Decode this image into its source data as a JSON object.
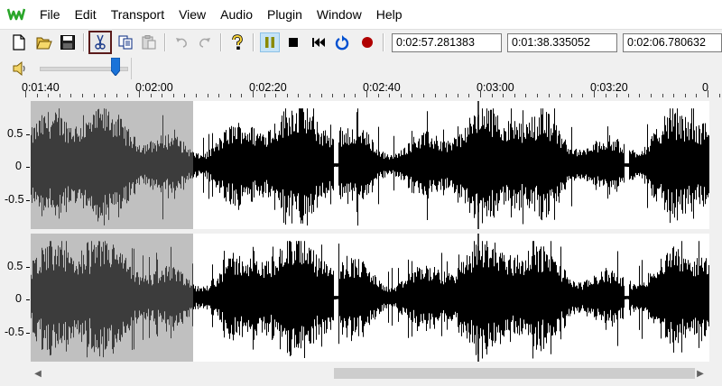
{
  "menu": {
    "items": [
      "File",
      "Edit",
      "Transport",
      "View",
      "Audio",
      "Plugin",
      "Window",
      "Help"
    ]
  },
  "toolbar": {
    "buttons": [
      {
        "name": "new-file-button",
        "icon": "new-file-icon"
      },
      {
        "name": "open-button",
        "icon": "folder-open-icon"
      },
      {
        "name": "save-button",
        "icon": "save-icon"
      },
      {
        "name": "cut-button",
        "icon": "scissors-icon",
        "highlighted": true
      },
      {
        "name": "copy-button",
        "icon": "copy-icon"
      },
      {
        "name": "paste-button",
        "icon": "paste-icon",
        "disabled": true
      },
      {
        "name": "undo-button",
        "icon": "undo-icon",
        "disabled": true
      },
      {
        "name": "redo-button",
        "icon": "redo-icon",
        "disabled": true
      },
      {
        "name": "help-button",
        "icon": "question-icon"
      },
      {
        "name": "pause-button",
        "icon": "pause-icon",
        "active": true
      },
      {
        "name": "stop-button",
        "icon": "stop-icon"
      },
      {
        "name": "rewind-button",
        "icon": "skip-back-icon"
      },
      {
        "name": "loop-button",
        "icon": "loop-icon"
      },
      {
        "name": "record-button",
        "icon": "record-icon"
      }
    ],
    "time_cursor": "0:02:57.281383",
    "time_selection_start": "0:01:38.335052",
    "time_selection_end": "0:02:06.780632"
  },
  "volume": {
    "icon": "speaker-icon",
    "level": 0.9
  },
  "ruler": {
    "labels": [
      "0:01:40",
      "0:02:00",
      "0:02:20",
      "0:02:40",
      "0:03:00",
      "0:03:20",
      "0"
    ]
  },
  "scale": {
    "labels": [
      "0.5",
      "0",
      "-0.5"
    ]
  },
  "colors": {
    "waveform": "#000000",
    "selection_background": "#c0c0c0",
    "selection_waveform": "#3c3c3c",
    "cursor_line": "#000000",
    "pause_active": "#8a8a00",
    "loop": "#0050d0",
    "record": "#b00000"
  }
}
